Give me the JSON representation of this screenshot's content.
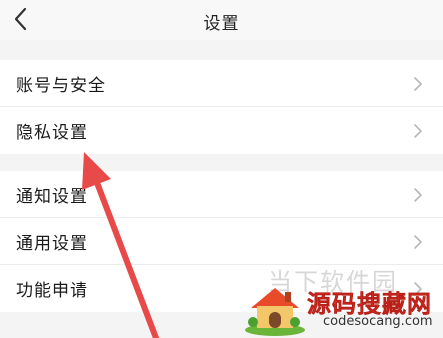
{
  "header": {
    "title": "设置",
    "back_icon": "chevron-left-icon"
  },
  "sections": [
    {
      "items": [
        {
          "label": "账号与安全",
          "icon": "chevron-right-icon"
        },
        {
          "label": "隐私设置",
          "icon": "chevron-right-icon"
        }
      ]
    },
    {
      "items": [
        {
          "label": "通知设置",
          "icon": "chevron-right-icon"
        },
        {
          "label": "通用设置",
          "icon": "chevron-right-icon"
        },
        {
          "label": "功能申请",
          "icon": "chevron-right-icon"
        }
      ]
    }
  ],
  "annotation": {
    "arrow_color": "#e84a4a",
    "points_to": "隐私设置"
  },
  "watermark": {
    "faint_text": "当下软件园",
    "brand_text": "源码搜藏网",
    "domain": "codesocang.com",
    "brand_color": "#e8342a"
  },
  "colors": {
    "background": "#f4f4f4",
    "row_background": "#ffffff",
    "chevron": "#b8b8b8",
    "text": "#1a1a1a"
  }
}
